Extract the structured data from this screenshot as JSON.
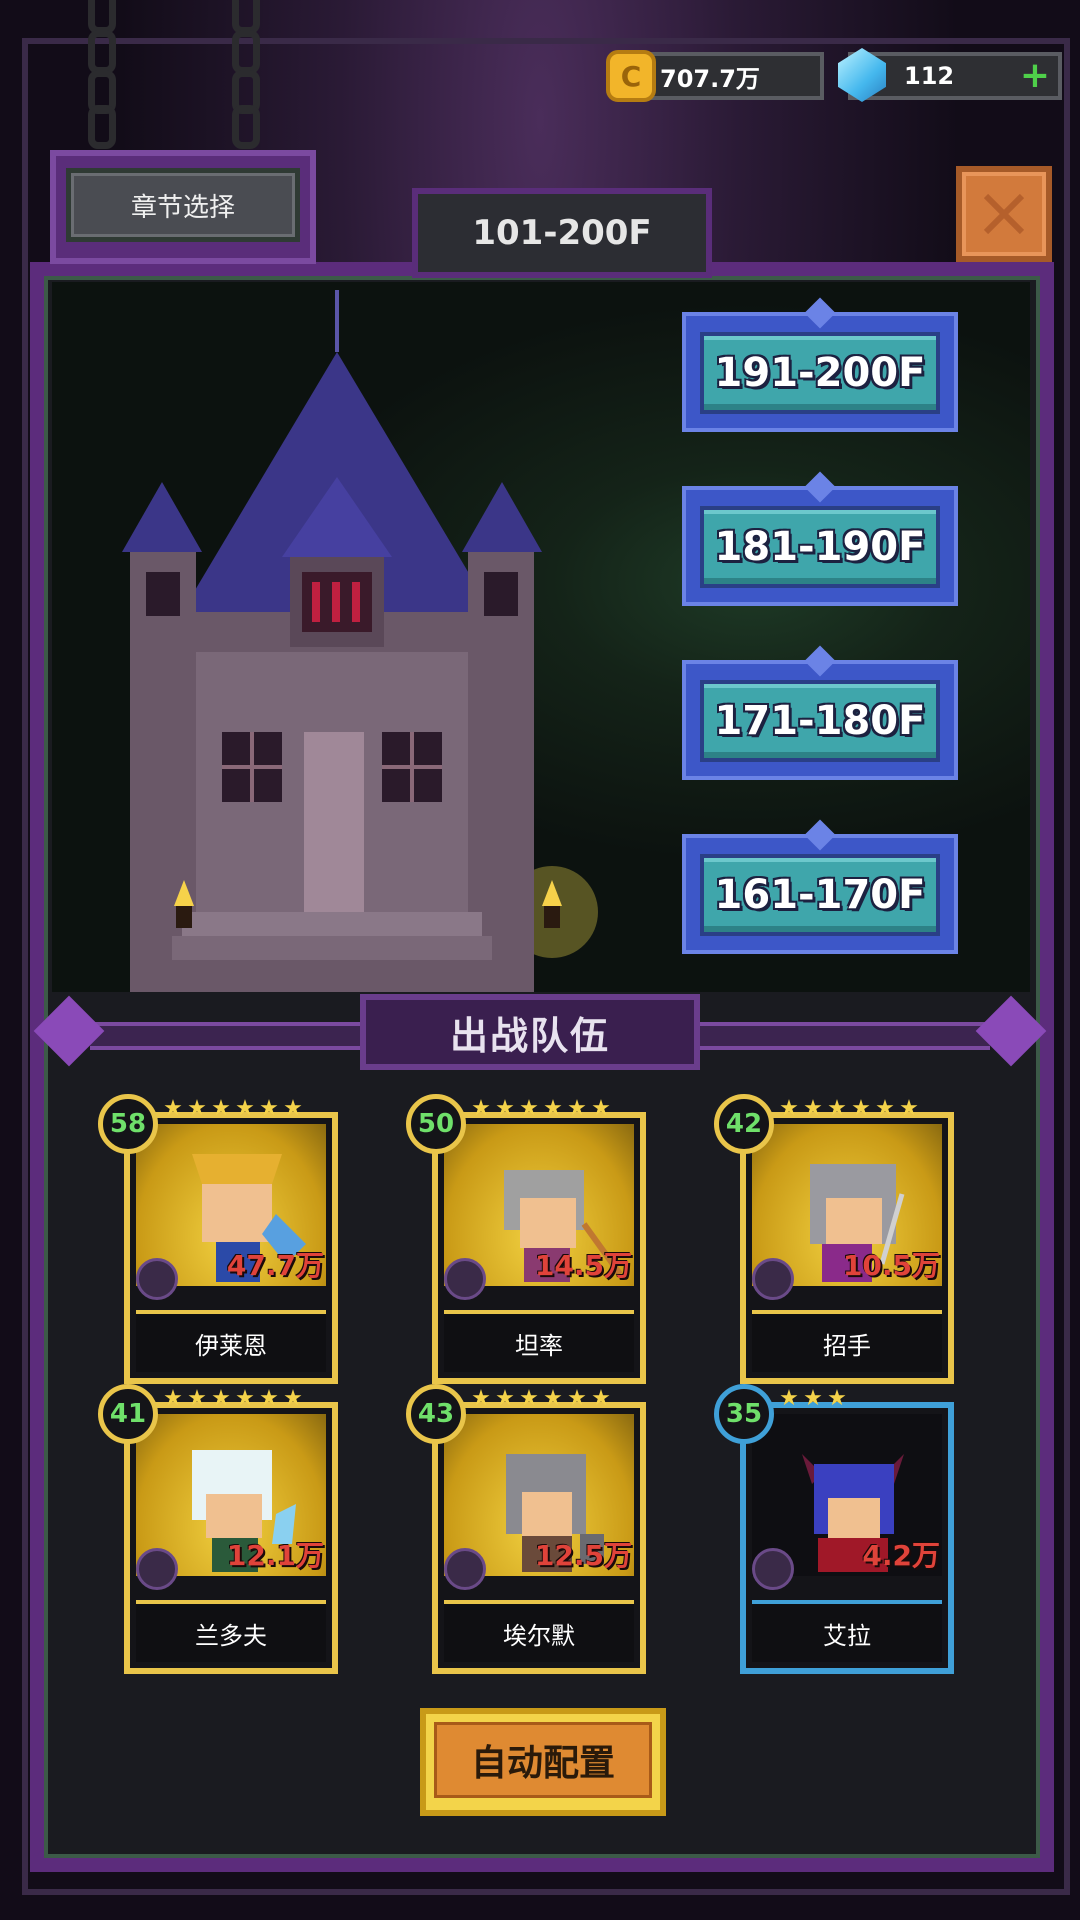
{
  "currency": {
    "coins": "707.7万",
    "gems": "112",
    "coin_symbol": "C"
  },
  "header": {
    "chapter_select": "章节选择",
    "range": "101-200F"
  },
  "floors": [
    {
      "label": "191-200F"
    },
    {
      "label": "181-190F"
    },
    {
      "label": "171-180F"
    },
    {
      "label": "161-170F"
    }
  ],
  "team": {
    "title": "出战队伍",
    "heroes": [
      {
        "level": "58",
        "power": "47.7万",
        "name": "伊莱恩",
        "stars": 6,
        "rarity": "gold"
      },
      {
        "level": "50",
        "power": "14.5万",
        "name": "坦率",
        "stars": 6,
        "rarity": "gold"
      },
      {
        "level": "42",
        "power": "10.5万",
        "name": "招手",
        "stars": 6,
        "rarity": "gold"
      },
      {
        "level": "41",
        "power": "12.1万",
        "name": "兰多夫",
        "stars": 6,
        "rarity": "gold"
      },
      {
        "level": "43",
        "power": "12.5万",
        "name": "埃尔默",
        "stars": 6,
        "rarity": "gold"
      },
      {
        "level": "35",
        "power": "4.2万",
        "name": "艾拉",
        "stars": 3,
        "rarity": "blue"
      }
    ]
  },
  "auto_config": "自动配置",
  "colors": {
    "frame_purple": "#5c2c7c",
    "gold": "#e9c54a",
    "teal_button": "#3fa6ab",
    "level_green": "#6fe06a",
    "power_red": "#e0433a"
  }
}
